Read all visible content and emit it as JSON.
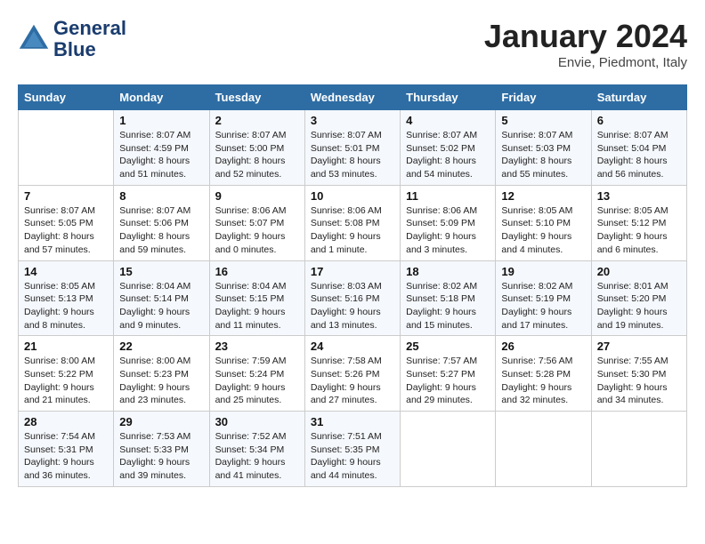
{
  "header": {
    "logo_line1": "General",
    "logo_line2": "Blue",
    "month_title": "January 2024",
    "location": "Envie, Piedmont, Italy"
  },
  "days_of_week": [
    "Sunday",
    "Monday",
    "Tuesday",
    "Wednesday",
    "Thursday",
    "Friday",
    "Saturday"
  ],
  "weeks": [
    [
      {
        "day": "",
        "sunrise": "",
        "sunset": "",
        "daylight": ""
      },
      {
        "day": "1",
        "sunrise": "Sunrise: 8:07 AM",
        "sunset": "Sunset: 4:59 PM",
        "daylight": "Daylight: 8 hours and 51 minutes."
      },
      {
        "day": "2",
        "sunrise": "Sunrise: 8:07 AM",
        "sunset": "Sunset: 5:00 PM",
        "daylight": "Daylight: 8 hours and 52 minutes."
      },
      {
        "day": "3",
        "sunrise": "Sunrise: 8:07 AM",
        "sunset": "Sunset: 5:01 PM",
        "daylight": "Daylight: 8 hours and 53 minutes."
      },
      {
        "day": "4",
        "sunrise": "Sunrise: 8:07 AM",
        "sunset": "Sunset: 5:02 PM",
        "daylight": "Daylight: 8 hours and 54 minutes."
      },
      {
        "day": "5",
        "sunrise": "Sunrise: 8:07 AM",
        "sunset": "Sunset: 5:03 PM",
        "daylight": "Daylight: 8 hours and 55 minutes."
      },
      {
        "day": "6",
        "sunrise": "Sunrise: 8:07 AM",
        "sunset": "Sunset: 5:04 PM",
        "daylight": "Daylight: 8 hours and 56 minutes."
      }
    ],
    [
      {
        "day": "7",
        "sunrise": "Sunrise: 8:07 AM",
        "sunset": "Sunset: 5:05 PM",
        "daylight": "Daylight: 8 hours and 57 minutes."
      },
      {
        "day": "8",
        "sunrise": "Sunrise: 8:07 AM",
        "sunset": "Sunset: 5:06 PM",
        "daylight": "Daylight: 8 hours and 59 minutes."
      },
      {
        "day": "9",
        "sunrise": "Sunrise: 8:06 AM",
        "sunset": "Sunset: 5:07 PM",
        "daylight": "Daylight: 9 hours and 0 minutes."
      },
      {
        "day": "10",
        "sunrise": "Sunrise: 8:06 AM",
        "sunset": "Sunset: 5:08 PM",
        "daylight": "Daylight: 9 hours and 1 minute."
      },
      {
        "day": "11",
        "sunrise": "Sunrise: 8:06 AM",
        "sunset": "Sunset: 5:09 PM",
        "daylight": "Daylight: 9 hours and 3 minutes."
      },
      {
        "day": "12",
        "sunrise": "Sunrise: 8:05 AM",
        "sunset": "Sunset: 5:10 PM",
        "daylight": "Daylight: 9 hours and 4 minutes."
      },
      {
        "day": "13",
        "sunrise": "Sunrise: 8:05 AM",
        "sunset": "Sunset: 5:12 PM",
        "daylight": "Daylight: 9 hours and 6 minutes."
      }
    ],
    [
      {
        "day": "14",
        "sunrise": "Sunrise: 8:05 AM",
        "sunset": "Sunset: 5:13 PM",
        "daylight": "Daylight: 9 hours and 8 minutes."
      },
      {
        "day": "15",
        "sunrise": "Sunrise: 8:04 AM",
        "sunset": "Sunset: 5:14 PM",
        "daylight": "Daylight: 9 hours and 9 minutes."
      },
      {
        "day": "16",
        "sunrise": "Sunrise: 8:04 AM",
        "sunset": "Sunset: 5:15 PM",
        "daylight": "Daylight: 9 hours and 11 minutes."
      },
      {
        "day": "17",
        "sunrise": "Sunrise: 8:03 AM",
        "sunset": "Sunset: 5:16 PM",
        "daylight": "Daylight: 9 hours and 13 minutes."
      },
      {
        "day": "18",
        "sunrise": "Sunrise: 8:02 AM",
        "sunset": "Sunset: 5:18 PM",
        "daylight": "Daylight: 9 hours and 15 minutes."
      },
      {
        "day": "19",
        "sunrise": "Sunrise: 8:02 AM",
        "sunset": "Sunset: 5:19 PM",
        "daylight": "Daylight: 9 hours and 17 minutes."
      },
      {
        "day": "20",
        "sunrise": "Sunrise: 8:01 AM",
        "sunset": "Sunset: 5:20 PM",
        "daylight": "Daylight: 9 hours and 19 minutes."
      }
    ],
    [
      {
        "day": "21",
        "sunrise": "Sunrise: 8:00 AM",
        "sunset": "Sunset: 5:22 PM",
        "daylight": "Daylight: 9 hours and 21 minutes."
      },
      {
        "day": "22",
        "sunrise": "Sunrise: 8:00 AM",
        "sunset": "Sunset: 5:23 PM",
        "daylight": "Daylight: 9 hours and 23 minutes."
      },
      {
        "day": "23",
        "sunrise": "Sunrise: 7:59 AM",
        "sunset": "Sunset: 5:24 PM",
        "daylight": "Daylight: 9 hours and 25 minutes."
      },
      {
        "day": "24",
        "sunrise": "Sunrise: 7:58 AM",
        "sunset": "Sunset: 5:26 PM",
        "daylight": "Daylight: 9 hours and 27 minutes."
      },
      {
        "day": "25",
        "sunrise": "Sunrise: 7:57 AM",
        "sunset": "Sunset: 5:27 PM",
        "daylight": "Daylight: 9 hours and 29 minutes."
      },
      {
        "day": "26",
        "sunrise": "Sunrise: 7:56 AM",
        "sunset": "Sunset: 5:28 PM",
        "daylight": "Daylight: 9 hours and 32 minutes."
      },
      {
        "day": "27",
        "sunrise": "Sunrise: 7:55 AM",
        "sunset": "Sunset: 5:30 PM",
        "daylight": "Daylight: 9 hours and 34 minutes."
      }
    ],
    [
      {
        "day": "28",
        "sunrise": "Sunrise: 7:54 AM",
        "sunset": "Sunset: 5:31 PM",
        "daylight": "Daylight: 9 hours and 36 minutes."
      },
      {
        "day": "29",
        "sunrise": "Sunrise: 7:53 AM",
        "sunset": "Sunset: 5:33 PM",
        "daylight": "Daylight: 9 hours and 39 minutes."
      },
      {
        "day": "30",
        "sunrise": "Sunrise: 7:52 AM",
        "sunset": "Sunset: 5:34 PM",
        "daylight": "Daylight: 9 hours and 41 minutes."
      },
      {
        "day": "31",
        "sunrise": "Sunrise: 7:51 AM",
        "sunset": "Sunset: 5:35 PM",
        "daylight": "Daylight: 9 hours and 44 minutes."
      },
      {
        "day": "",
        "sunrise": "",
        "sunset": "",
        "daylight": ""
      },
      {
        "day": "",
        "sunrise": "",
        "sunset": "",
        "daylight": ""
      },
      {
        "day": "",
        "sunrise": "",
        "sunset": "",
        "daylight": ""
      }
    ]
  ]
}
